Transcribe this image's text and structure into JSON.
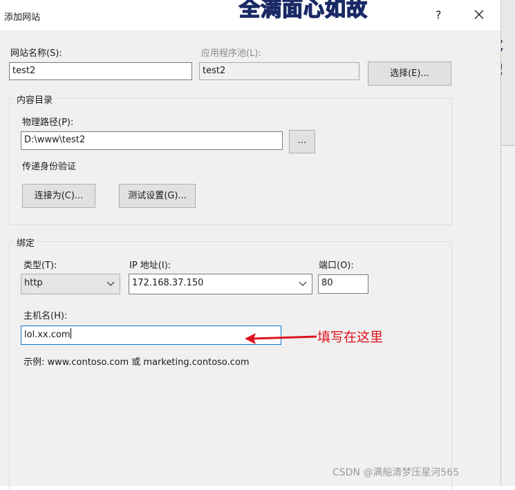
{
  "window": {
    "title": "添加网站",
    "help": "?",
    "close": "✕"
  },
  "background": {
    "overlay_top": "全满面心如故",
    "overlay_right": "是宇"
  },
  "site": {
    "name_label": "网站名称(S):",
    "name_value": "test2",
    "pool_label": "应用程序池(L):",
    "pool_value": "test2",
    "select_button": "选择(E)..."
  },
  "content": {
    "group_title": "内容目录",
    "path_label": "物理路径(P):",
    "path_value": "D:\\www\\test2",
    "browse_button": "...",
    "auth_label": "传递身份验证",
    "connect_button": "连接为(C)...",
    "test_button": "测试设置(G)..."
  },
  "binding": {
    "group_title": "绑定",
    "type_label": "类型(T):",
    "type_value": "http",
    "ip_label": "IP 地址(I):",
    "ip_value": "172.168.37.150",
    "port_label": "端口(O):",
    "port_value": "80",
    "host_label": "主机名(H):",
    "host_value": "lol.xx.com",
    "example": "示例: www.contoso.com 或 marketing.contoso.com"
  },
  "annotation": {
    "text": "填写在这里",
    "color": "#e0131e"
  },
  "watermark": "CSDN @满船清梦压星河565"
}
